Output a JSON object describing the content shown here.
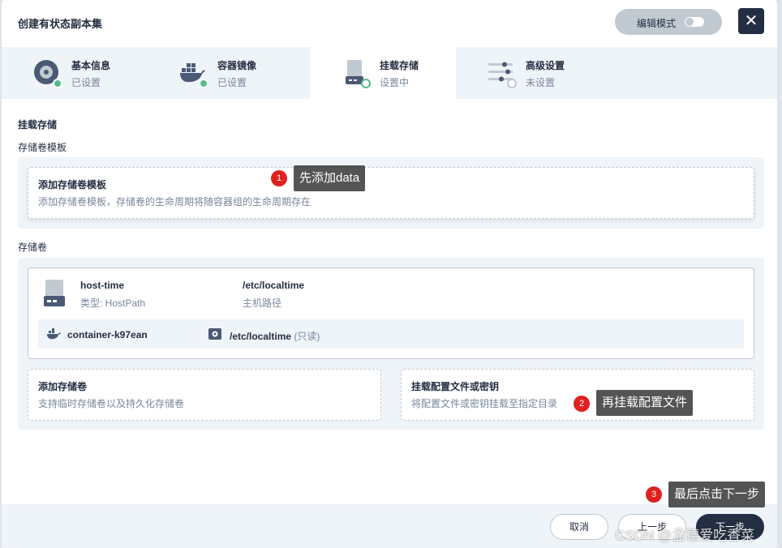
{
  "header": {
    "title": "创建有状态副本集",
    "edit_mode_label": "编辑模式",
    "close_glyph": "✕"
  },
  "tabs": [
    {
      "title": "基本信息",
      "status": "已设置",
      "icon": "disk-icon",
      "state": "done"
    },
    {
      "title": "容器镜像",
      "status": "已设置",
      "icon": "docker-icon",
      "state": "done"
    },
    {
      "title": "挂载存储",
      "status": "设置中",
      "icon": "storage-icon",
      "state": "current"
    },
    {
      "title": "高级设置",
      "status": "未设置",
      "icon": "sliders-icon",
      "state": "todo"
    }
  ],
  "main": {
    "section_title": "挂载存储",
    "template_label": "存储卷模板",
    "add_template": {
      "title": "添加存储卷模板",
      "desc": "添加存储卷模板，存储卷的生命周期将随容器组的生命周期存在"
    },
    "volumes_label": "存储卷",
    "volume": {
      "name": "host-time",
      "type": "类型: HostPath",
      "path": "/etc/localtime",
      "path_label": "主机路径",
      "container": "container-k97ean",
      "mount_path": "/etc/localtime",
      "mount_mode": "(只读)"
    },
    "add_volume": {
      "title": "添加存储卷",
      "desc": "支持临时存储卷以及持久化存储卷"
    },
    "mount_config": {
      "title": "挂载配置文件或密钥",
      "desc": "将配置文件或密钥挂载至指定目录"
    }
  },
  "annotations": [
    {
      "num": "1",
      "text": "先添加data"
    },
    {
      "num": "2",
      "text": "再挂载配置文件"
    },
    {
      "num": "3",
      "text": "最后点击下一步"
    }
  ],
  "footer": {
    "cancel": "取消",
    "prev": "上一步",
    "next": "下一步"
  },
  "watermark": "CSDN @孟德爱吃香菜",
  "colors": {
    "primary_dark": "#242e42",
    "success": "#55bc8a",
    "muted": "#79879c",
    "panel_bg": "#eff4f9",
    "badge_red": "#e02020"
  }
}
